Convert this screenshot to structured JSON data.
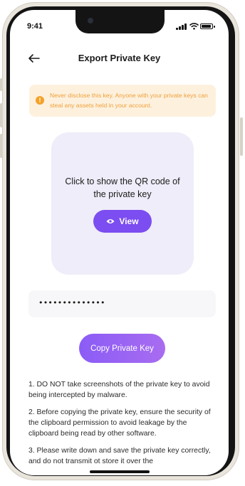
{
  "status_bar": {
    "time": "9:41"
  },
  "header": {
    "title": "Export Private Key"
  },
  "warning": {
    "text": "Never disclose this key. Anyone with your private keys can steal any assets held in your account."
  },
  "qr_card": {
    "prompt": "Click to show the QR code of the private key",
    "view_label": "View"
  },
  "key_field": {
    "masked_value": "••••••••••••••"
  },
  "copy_button": {
    "label": "Copy Private Key"
  },
  "notes": [
    "1. DO NOT take screenshots of the private key to avoid being intercepted by malware.",
    "2. Before copying the private key, ensure the security of the clipboard permission to avoid leakage by the clipboard being read by other software.",
    "3. Please write down and save the private key correctly, and do not transmit ot store it over the"
  ],
  "colors": {
    "accent": "#7c4df0",
    "warning_bg": "#fdf1de",
    "warning_text": "#f0a03a"
  },
  "icons": {
    "back": "arrow-left-icon",
    "warning": "alert-circle-icon",
    "view": "eye-icon"
  }
}
